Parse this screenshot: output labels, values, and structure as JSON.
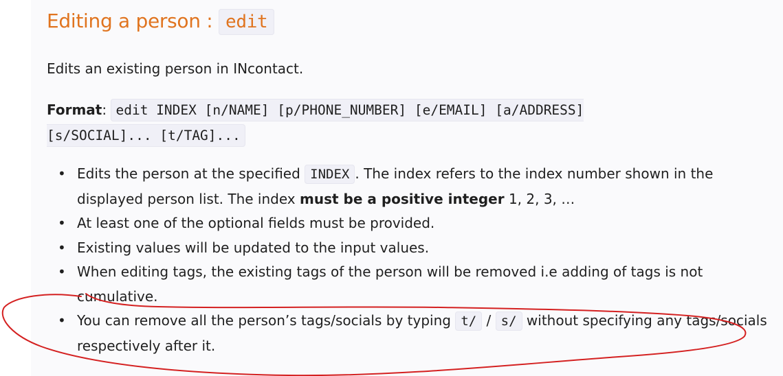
{
  "heading": {
    "text": "Editing a person : ",
    "code": "edit"
  },
  "description": "Edits an existing person in INcontact.",
  "format": {
    "label": "Format",
    "sep": ": ",
    "command": "edit INDEX [n/NAME] [p/PHONE_NUMBER] [e/EMAIL] [a/ADDRESS] [s/SOCIAL]... [t/TAG]..."
  },
  "bullets": {
    "b1": {
      "pre": "Edits the person at the specified ",
      "code": "INDEX",
      "mid": ". The index refers to the index number shown in the displayed person list. The index ",
      "bold": "must be a positive integer",
      "post": " 1, 2, 3, …"
    },
    "b2": "At least one of the optional fields must be provided.",
    "b3": "Existing values will be updated to the input values.",
    "b4": "When editing tags, the existing tags of the person will be removed i.e adding of tags is not cumulative.",
    "b5": {
      "pre": "You can remove all the person’s tags/socials by typing ",
      "code1": "t/",
      "slash": " / ",
      "code2": "s/",
      "post": " without specifying any tags/socials respectively after it."
    }
  },
  "annotation": {
    "color": "#d42020"
  }
}
